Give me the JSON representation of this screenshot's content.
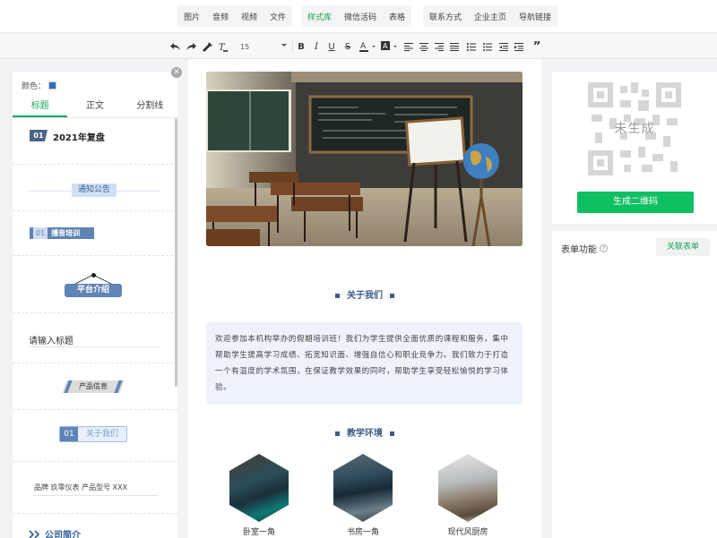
{
  "topbar": {
    "group1": [
      "图片",
      "音频",
      "视频",
      "文件"
    ],
    "group2": [
      "样式库",
      "微信活码",
      "表格"
    ],
    "group3": [
      "联系方式",
      "企业主页",
      "导航链接"
    ]
  },
  "toolbar": {
    "font_size": "15"
  },
  "left_panel": {
    "color_label": "颜色：",
    "color_value": "#2c6fc7",
    "tabs": [
      "标题",
      "正文",
      "分割线"
    ],
    "templates": {
      "t1_num": "01",
      "t1_text": "2021年复盘",
      "t2_text": "通知公告",
      "t3_num": "01",
      "t3_text": "播音培训",
      "t4_text": "平台介绍",
      "t5_text": "请输入标题",
      "t6_text": "产品信息",
      "t7_num": "01",
      "t7_text": "关于我们",
      "t8_text": "品牌 玖零仪表    产品型号 XXX",
      "t9_text": "公司简介"
    }
  },
  "editor": {
    "section1_title": "关于我们",
    "intro_text": "欢迎参加本机构举办的假期培训班！我们为学生提供全面优质的课程和服务，集中帮助学生提高学习成绩、拓宽知识面、增强自信心和职业竞争力。我们致力于打造一个有温度的学术氛围，在保证教学效果的同时，帮助学生享受轻松愉悦的学习体验。",
    "section2_title": "教学环境",
    "captions": [
      "卧室一角",
      "书房一角",
      "现代风厨房"
    ]
  },
  "right_panel": {
    "qr_placeholder": "未生成",
    "qr_button": "生成二维码",
    "form_label": "表单功能",
    "form_link": "关联表单"
  },
  "colors": {
    "accent_green": "#0fbf62",
    "title_blue": "#3c5b86"
  }
}
